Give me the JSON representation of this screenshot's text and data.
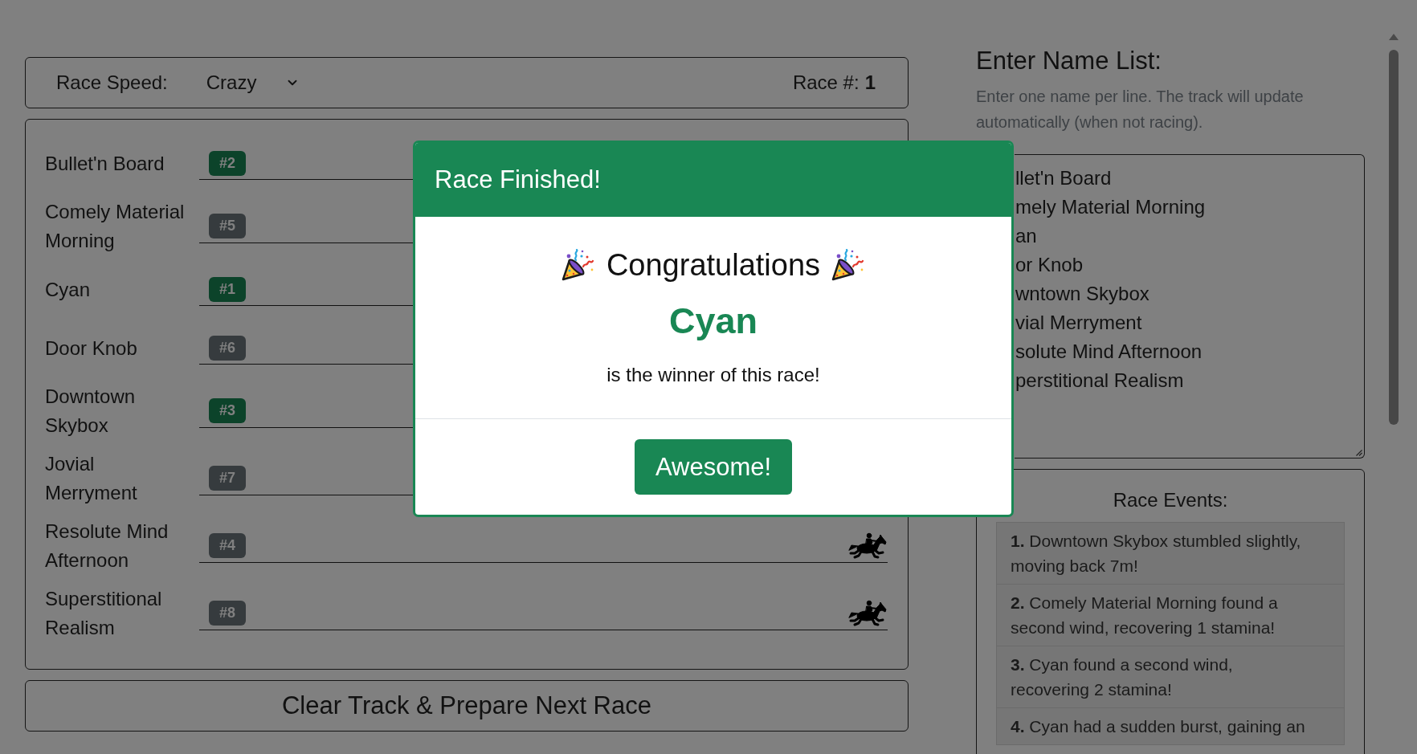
{
  "race_settings": {
    "speed_label": "Race Speed:",
    "speed_select": {
      "value": "Crazy"
    },
    "race_number": {
      "label": "Race #:",
      "value": "1"
    }
  },
  "lanes": [
    {
      "name": "Bullet'n Board",
      "badge": "#2",
      "color": "#0c432a"
    },
    {
      "name": "Comely Material Morning",
      "badge": "#5",
      "color": "#363b3e"
    },
    {
      "name": "Cyan",
      "badge": "#1",
      "color": "#0c432a"
    },
    {
      "name": "Door Knob",
      "badge": "#6",
      "color": "#363b3e"
    },
    {
      "name": "Downtown Skybox",
      "badge": "#3",
      "color": "#0c432a"
    },
    {
      "name": "Jovial Merryment",
      "badge": "#7",
      "color": "#363b3e"
    },
    {
      "name": "Resolute Mind Afternoon",
      "badge": "#4",
      "color": "#363b3e",
      "horse_visible": true
    },
    {
      "name": "Superstitional Realism",
      "badge": "#8",
      "color": "#363b3e",
      "horse_visible": true
    }
  ],
  "clear_button": "Clear Track & Prepare Next Race",
  "name_list": {
    "title": "Enter Name List:",
    "help": "Enter one name per line. The track will update automatically (when not racing).",
    "lines": [
      "llet'n Board",
      "mely Material Morning",
      "an",
      "or Knob",
      "wntown Skybox",
      "vial Merryment",
      "solute Mind Afternoon",
      "perstitional Realism"
    ]
  },
  "race_events": {
    "title": "Race Events:",
    "items": [
      "**1.** Downtown Skybox stumbled slightly, moving back 7m!",
      "**2.** Comely Material Morning found a second wind, recovering 1 stamina!",
      "**3.** Cyan found a second wind, recovering 2 stamina!",
      "**4.** Cyan had a sudden burst, gaining an"
    ]
  },
  "dialog": {
    "title": "Race Finished!",
    "heading": "Congratulations",
    "winner": "Cyan",
    "message": "is the winner of this race!",
    "button": "Awesome!"
  }
}
